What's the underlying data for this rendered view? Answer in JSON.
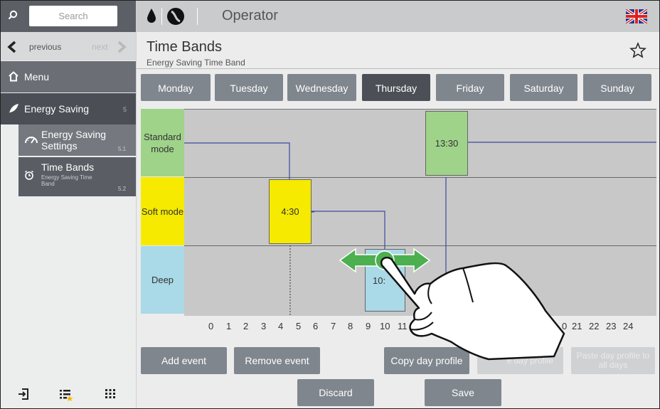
{
  "sidebar": {
    "search_placeholder": "Search",
    "previous_label": "previous",
    "next_label": "next",
    "menu_label": "Menu",
    "energy_saving": {
      "label": "Energy Saving",
      "number": "5"
    },
    "items": [
      {
        "label": "Energy Saving Settings",
        "number": "5.1"
      },
      {
        "label": "Time Bands",
        "sublabel": "Energy Saving Time Band",
        "number": "5.2"
      }
    ]
  },
  "header": {
    "role": "Operator",
    "language_icon": "uk-flag-icon"
  },
  "page": {
    "title": "Time Bands",
    "subtitle": "Energy Saving Time Band"
  },
  "days": [
    "Monday",
    "Tuesday",
    "Wednesday",
    "Thursday",
    "Friday",
    "Saturday",
    "Sunday"
  ],
  "active_day": "Thursday",
  "bands": [
    {
      "label": "Standard mode",
      "color": "#9fd38a"
    },
    {
      "label": "Soft mode",
      "color": "#f5ea00"
    },
    {
      "label": "Deep",
      "color": "#aad9e7"
    }
  ],
  "events": [
    {
      "time": "4:30",
      "band": "Soft mode"
    },
    {
      "time": "10:",
      "band": "Deep"
    },
    {
      "time": "13:30",
      "band": "Standard mode"
    }
  ],
  "hours_axis": {
    "left": [
      "0",
      "1",
      "2",
      "3",
      "4",
      "5",
      "6",
      "7",
      "8",
      "9",
      "10",
      "11"
    ],
    "right": [
      "0",
      "21",
      "22",
      "23",
      "24"
    ]
  },
  "buttons": {
    "add_event": "Add event",
    "remove_event": "Remove event",
    "copy_day_profile": "Copy day profile",
    "paste_day_profile": "e day profile",
    "paste_all_days": "Paste day profile to all days",
    "discard": "Discard",
    "save": "Save"
  },
  "colors": {
    "line": "#3a4aa0",
    "drag_arrow": "#4caf50",
    "active_tab": "#4c5056",
    "tab": "#80868e"
  }
}
